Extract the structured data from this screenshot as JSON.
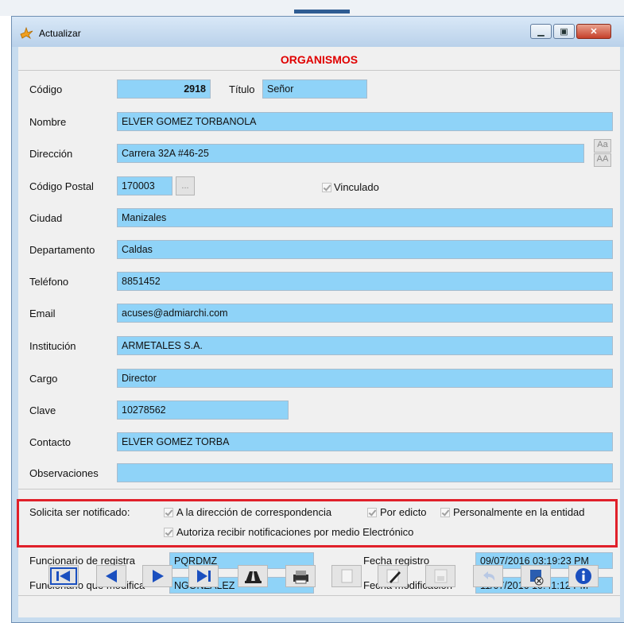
{
  "window": {
    "title": "Actualizar"
  },
  "form": {
    "heading": "ORGANISMOS",
    "codigo": {
      "label": "Código",
      "value": "2918"
    },
    "titulo": {
      "label": "Título",
      "value": "Señor"
    },
    "nombre": {
      "label": "Nombre",
      "value": "ELVER GOMEZ TORBANOLA"
    },
    "direccion": {
      "label": "Dirección",
      "value": "Carrera 32A #46-25",
      "case_btn_1": "Aa",
      "case_btn_2": "AA"
    },
    "codigo_postal": {
      "label": "Código Postal",
      "value": "170003",
      "lookup": "..."
    },
    "vinculado": {
      "label": "Vinculado",
      "checked": true
    },
    "ciudad": {
      "label": "Ciudad",
      "value": "Manizales"
    },
    "departamento": {
      "label": "Departamento",
      "value": "Caldas"
    },
    "telefono": {
      "label": "Teléfono",
      "value": "8851452"
    },
    "email": {
      "label": "Email",
      "value": "acuses@admiarchi.com"
    },
    "institucion": {
      "label": "Institución",
      "value": "ARMETALES S.A."
    },
    "cargo": {
      "label": "Cargo",
      "value": "Director"
    },
    "clave": {
      "label": "Clave",
      "value": "10278562"
    },
    "contacto": {
      "label": "Contacto",
      "value": "ELVER GOMEZ TORBA"
    },
    "observaciones": {
      "label": "Observaciones",
      "value": ""
    }
  },
  "notificacion": {
    "label": "Solicita ser notificado:",
    "opt_direccion": "A la dirección de correspondencia",
    "opt_edicto": "Por edicto",
    "opt_personal": "Personalmente en la entidad",
    "opt_electronico": "Autoriza recibir notificaciones por medio Electrónico"
  },
  "audit": {
    "registra_label": "Funcionario de registra",
    "registra_value": "PQRDMZ",
    "modifica_label": "Funcionario que modifica",
    "modifica_value": "NGONZALEZ",
    "fecha_registro_label": "Fecha registro",
    "fecha_registro_value": "09/07/2016 03:19:23 PM",
    "fecha_mod_label": "Fecha modificación",
    "fecha_mod_value": "11/07/2016 10:41:12 PM"
  },
  "toolbar": {
    "icons": [
      "first-record-icon",
      "previous-record-icon",
      "next-record-icon",
      "last-record-icon",
      "find-icon",
      "print-icon",
      "new-document-icon",
      "edit-icon",
      "save-icon",
      "undo-icon",
      "delete-icon",
      "info-icon"
    ]
  },
  "colors": {
    "field": "#8fd3f8",
    "heading": "#e00000",
    "highlight_box": "#e0202a"
  }
}
